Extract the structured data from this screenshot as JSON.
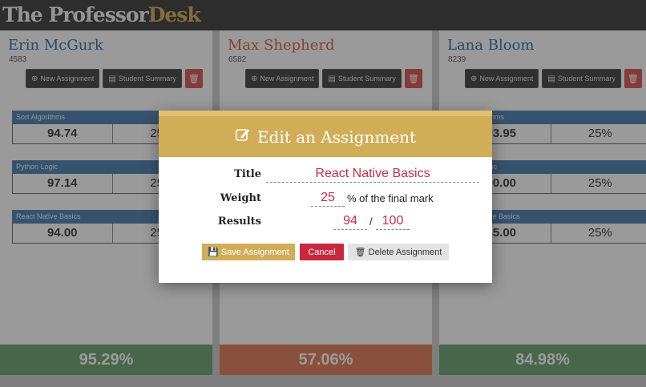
{
  "app": {
    "brand_part1": "The Professor",
    "brand_part2": "Desk"
  },
  "colors": {
    "brand_gold": "#d2ad58",
    "header_dark": "#3a3a3a",
    "assignment_blue": "#4a7fb0",
    "danger": "#c9283f",
    "success_green": "#6aa36e",
    "warning_orange": "#e07a57"
  },
  "buttons": {
    "new_assignment": "New Assignment",
    "student_summary": "Student Summary"
  },
  "students": [
    {
      "name": "Erin McGurk",
      "id": "4583",
      "name_color": "#2e6da4",
      "assignments": [
        {
          "title": "Sort Algorithms",
          "result": "94.74",
          "weight": "25%"
        },
        {
          "title": "Python Logic",
          "result": "97.14",
          "weight": "25%"
        },
        {
          "title": "React Native Basics",
          "result": "94.00",
          "weight": "25%"
        }
      ],
      "total": "95.29%",
      "total_color": "#6aa36e"
    },
    {
      "name": "Max Shepherd",
      "id": "6582",
      "name_color": "#d9603b",
      "assignments": [],
      "total": "57.06%",
      "total_color": "#e07a57"
    },
    {
      "name": "Lana Bloom",
      "id": "8239",
      "name_color": "#2e6da4",
      "assignments": [
        {
          "title": "Sort Algorithms",
          "result": "93.95",
          "weight": "25%"
        },
        {
          "title": "Python Logic",
          "result": "90.00",
          "weight": "25%"
        },
        {
          "title": "React Native Basics",
          "result": "85.00",
          "weight": "25%"
        }
      ],
      "total": "84.98%",
      "total_color": "#6aa36e"
    }
  ],
  "modal": {
    "title": "Edit an Assignment",
    "title_label": "Title",
    "title_value": "React Native Basics",
    "weight_label": "Weight",
    "weight_value": "25",
    "weight_suffix": "% of the final mark",
    "results_label": "Results",
    "results_value": "94",
    "results_separator": "/",
    "results_total": "100",
    "save_label": "Save Assignment",
    "cancel_label": "Cancel",
    "delete_label": "Delete Assignment"
  }
}
